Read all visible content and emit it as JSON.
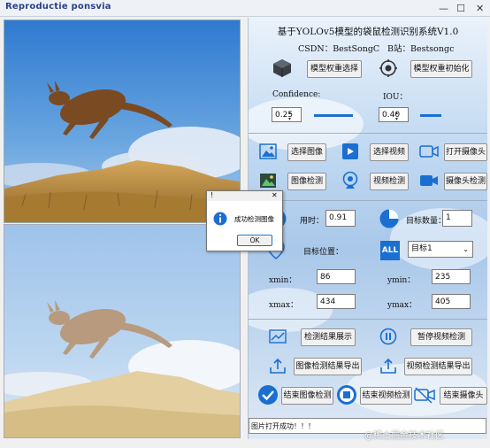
{
  "watermark": "Reproductie ponsvia",
  "window_buttons": {
    "minimize": "—",
    "maximize": "☐",
    "close": "✕"
  },
  "header": {
    "title": "基于YOLOv5模型的袋鼠检测识别系统V1.0",
    "csdn": "CSDN：BestSongC",
    "bilibili": "B站：Bestsongc"
  },
  "model": {
    "select_label": "模型权重选择",
    "init_label": "模型权重初始化"
  },
  "params": {
    "confidence_label": "Confidence:",
    "confidence_value": "0.25",
    "iou_label": "IOU：",
    "iou_value": "0.40"
  },
  "input_buttons": {
    "select_image": "选择图像",
    "select_video": "选择视频",
    "open_camera": "打开摄像头",
    "image_detect": "图像检测",
    "video_detect": "视频检测",
    "camera_detect": "摄像头检测"
  },
  "results": {
    "time_label": "用时：",
    "time_value": "0.91",
    "count_label": "目标数量：",
    "count_value": "1",
    "pos_label": "目标位置：",
    "target_select": "目标1",
    "all_icon_text": "ALL",
    "xmin_label": "xmin：",
    "xmin_value": "86",
    "ymin_label": "ymin：",
    "ymin_value": "235",
    "xmax_label": "xmax：",
    "xmax_value": "434",
    "ymax_label": "ymax：",
    "ymax_value": "405"
  },
  "actions": {
    "show_results": "检测结果展示",
    "pause_video": "暂停视频检测",
    "export_image": "图像检测结果导出",
    "export_video": "视频检测结果导出",
    "end_image": "结束图像检测",
    "end_video": "结束视频检测",
    "end_camera": "结束摄像头"
  },
  "status_text": "图片打开成功！！！",
  "csdn_watermark": "@稀土掘金技术社区",
  "dialog": {
    "title": "!",
    "message": "成功检测图像",
    "ok_label": "OK",
    "close": "✕"
  },
  "colors": {
    "accent": "#1a6fd1",
    "sky": "#3f8ed8",
    "grass": "#b78a3a"
  }
}
